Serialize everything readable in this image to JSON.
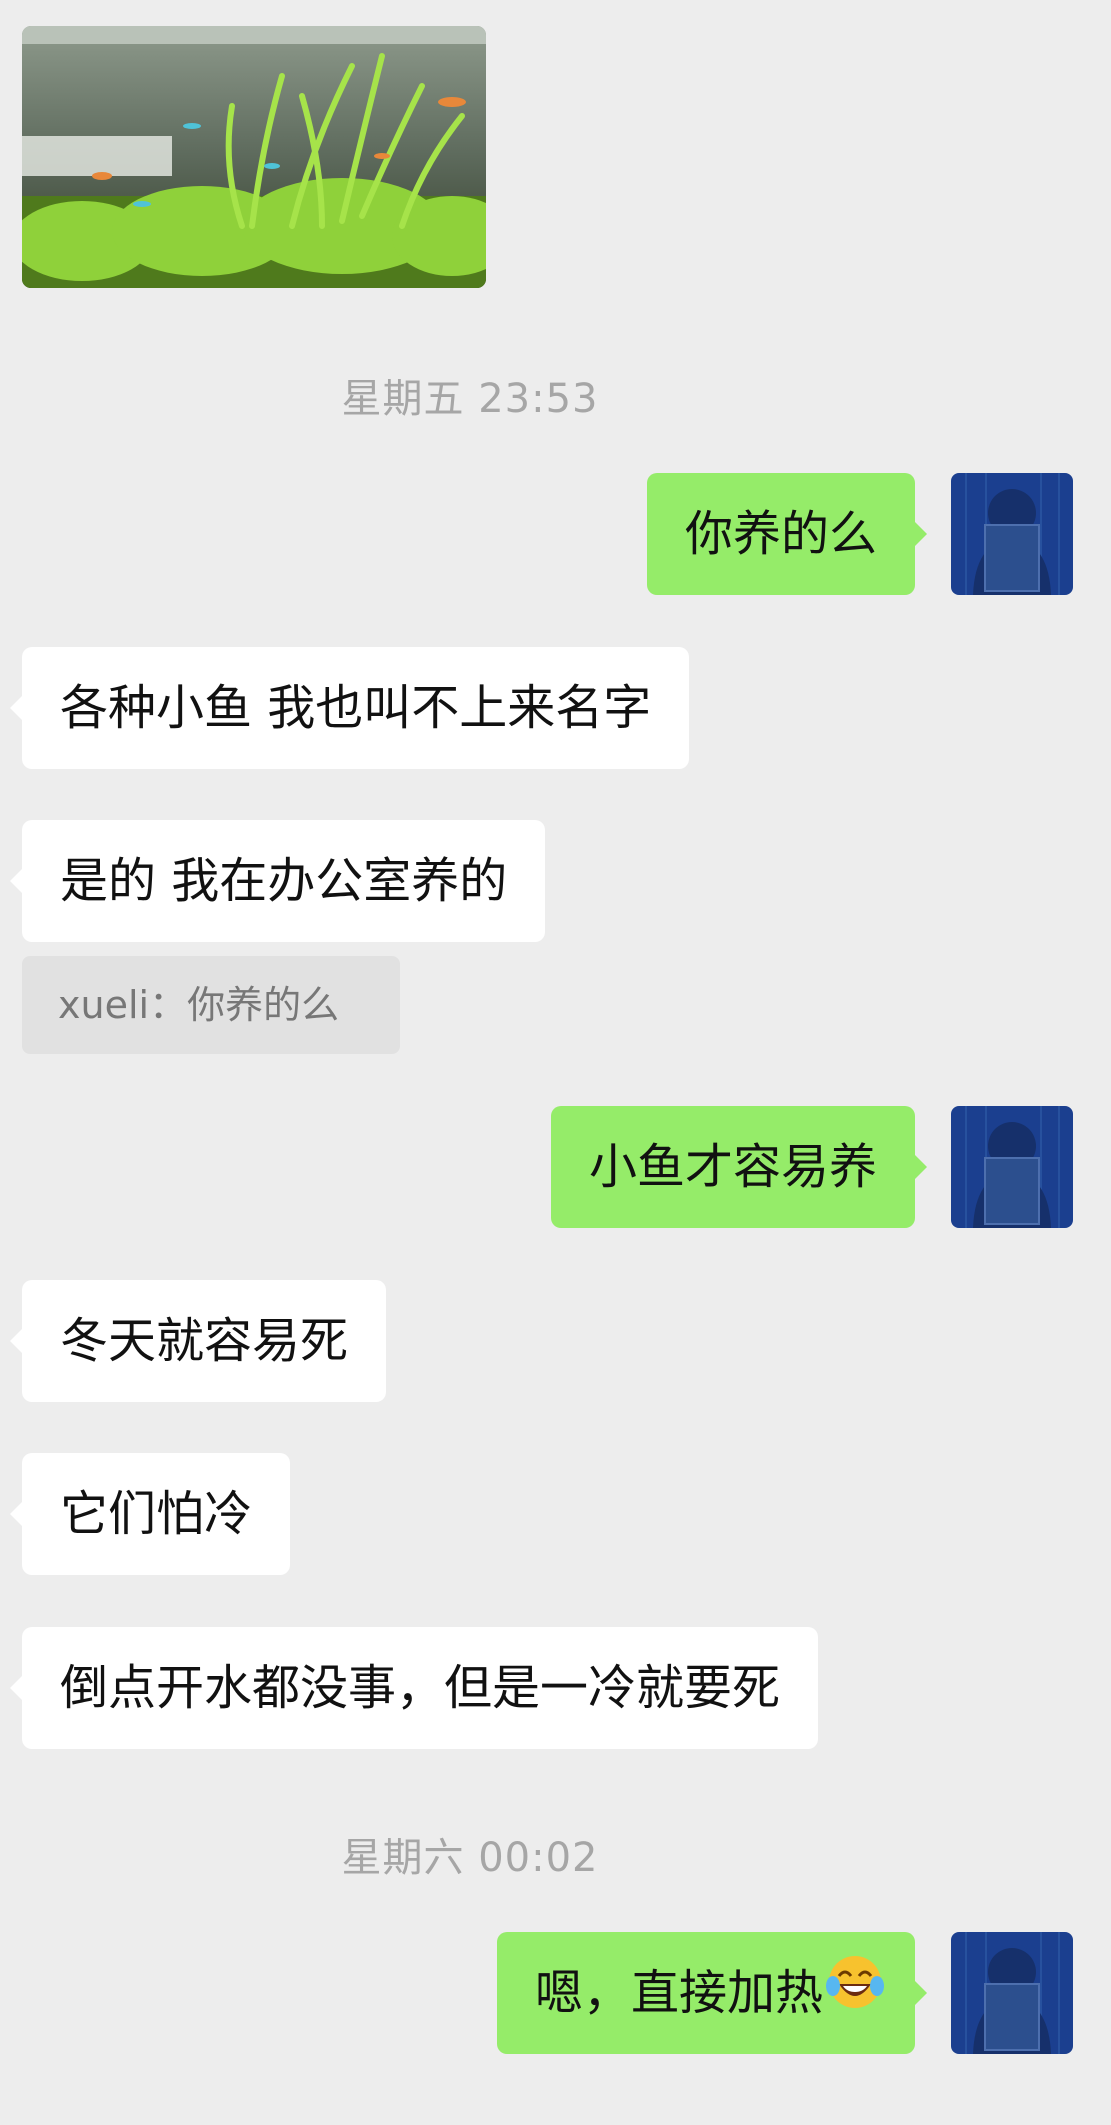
{
  "chat": {
    "photo_description": "aquarium",
    "time1": "星期五 23:53",
    "msg1": "你养的么",
    "msg2": "各种小鱼 我也叫不上来名字",
    "msg3": "是的 我在办公室养的",
    "quote": "xueli：你养的么",
    "msg4": "小鱼才容易养",
    "msg5": "冬天就容易死",
    "msg6": "它们怕冷",
    "msg7": "倒点开水都没事，但是一冷就要死",
    "time2": "星期六 00:02",
    "msg8": "嗯，直接加热",
    "msg8_emoji": "laughing-tears-emoji"
  },
  "colors": {
    "background": "#ededed",
    "sent_bubble": "#95ec69",
    "received_bubble": "#ffffff",
    "quote_bg": "#e1e1e1"
  }
}
